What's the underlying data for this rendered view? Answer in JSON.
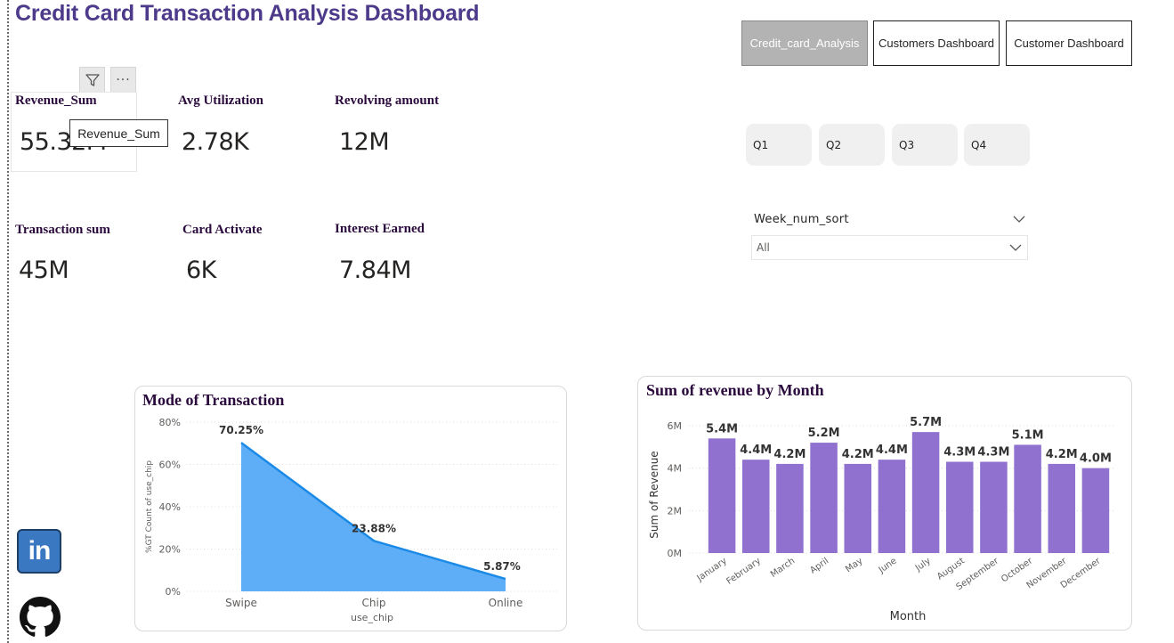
{
  "page": {
    "title": "Credit Card Transaction Analysis Dashboard"
  },
  "nav": {
    "buttons": [
      {
        "label": "Credit_card_Analysis",
        "active": true
      },
      {
        "label": "Customers Dashboard",
        "active": false
      },
      {
        "label": "Customer Dashboard",
        "active": false
      }
    ]
  },
  "kpis": {
    "revenue_sum": {
      "label": "Revenue_Sum",
      "value": "55.32M"
    },
    "avg_utilization": {
      "label": "Avg Utilization",
      "value": "2.78K"
    },
    "revolving_amount": {
      "label": "Revolving amount",
      "value": "12M"
    },
    "transaction_sum": {
      "label": "Transaction sum",
      "value": "45M"
    },
    "card_activate": {
      "label": "Card Activate",
      "value": "6K"
    },
    "interest_earned": {
      "label": "Interest Earned",
      "value": "7.84M"
    }
  },
  "tooltip": {
    "text": "Revenue_Sum"
  },
  "visual_header": {
    "filter_icon": "filter-icon",
    "more_icon": "more-options-icon",
    "more_glyph": "···"
  },
  "quarters": [
    "Q1",
    "Q2",
    "Q3",
    "Q4"
  ],
  "slicer": {
    "title": "Week_num_sort",
    "value": "All"
  },
  "social": {
    "linkedin_icon": "linkedin-icon",
    "linkedin_text": "in",
    "github_icon": "github-icon"
  },
  "colors": {
    "title": "#4d3a8a",
    "area_fill": "#5eaef7",
    "area_line": "#1a8ae6",
    "bar": "#9171d0",
    "chart_title": "#2b0a3d"
  },
  "chart_data": [
    {
      "type": "area",
      "title": "Mode of Transaction",
      "categories": [
        "Swipe",
        "Chip",
        "Online"
      ],
      "values": [
        70.25,
        23.88,
        5.87
      ],
      "data_labels": [
        "70.25%",
        "23.88%",
        "5.87%"
      ],
      "xlabel": "use_chip",
      "ylabel": "%GT Count of use_chip",
      "ylim": [
        0,
        80
      ],
      "yticks": [
        0,
        20,
        40,
        60,
        80
      ],
      "ytick_labels": [
        "0%",
        "20%",
        "40%",
        "60%",
        "80%"
      ],
      "grid": true
    },
    {
      "type": "bar",
      "title": "Sum of revenue by Month",
      "categories": [
        "January",
        "February",
        "March",
        "April",
        "May",
        "June",
        "July",
        "August",
        "September",
        "October",
        "November",
        "December"
      ],
      "values": [
        5.4,
        4.4,
        4.2,
        5.2,
        4.2,
        4.4,
        5.7,
        4.3,
        4.3,
        5.1,
        4.2,
        4.0
      ],
      "data_labels": [
        "5.4M",
        "4.4M",
        "4.2M",
        "5.2M",
        "4.2M",
        "4.4M",
        "5.7M",
        "4.3M",
        "4.3M",
        "5.1M",
        "4.2M",
        "4.0M"
      ],
      "xlabel": "Month",
      "ylabel": "Sum of Revenue",
      "ylim": [
        0,
        6
      ],
      "yticks": [
        0,
        2,
        4,
        6
      ],
      "ytick_labels": [
        "0M",
        "2M",
        "4M",
        "6M"
      ],
      "grid": true
    }
  ]
}
